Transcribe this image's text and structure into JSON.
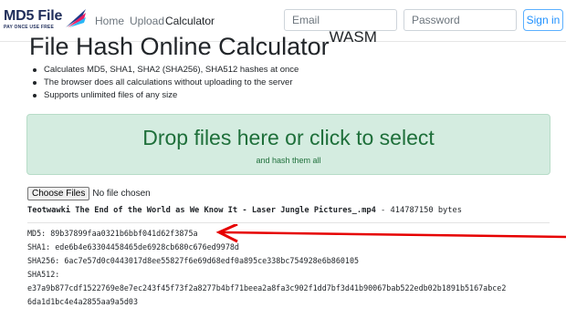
{
  "nav": {
    "logo_title": "MD5 File",
    "logo_tagline": "PAY ONCE USE FREE",
    "links": [
      {
        "label": "Home"
      },
      {
        "label": "Upload"
      },
      {
        "label": "Calculator"
      }
    ],
    "email_placeholder": "Email",
    "password_placeholder": "Password",
    "signin_label": "Sign in"
  },
  "page": {
    "title": "File Hash Online Calculator",
    "title_sup": "WASM",
    "bullets": [
      "Calculates MD5, SHA1, SHA2 (SHA256), SHA512 hashes at once",
      "The browser does all calculations without uploading to the server",
      "Supports unlimited files of any size"
    ]
  },
  "dropzone": {
    "title": "Drop files here or click to select",
    "subtitle": "and hash them all"
  },
  "file_input": {
    "button_label": "Choose Files",
    "status": "No file chosen"
  },
  "file": {
    "name": "Teotwawki The End of the World as We Know It - Laser Jungle Pictures_.mp4",
    "size_text": " - 414787150 bytes"
  },
  "hashes": {
    "md5_line": "MD5: 89b37899faa0321b6bbf041d62f3875a",
    "sha1_line": "SHA1: ede6b4e63304458465de6928cb680c676ed9978d",
    "sha256_line": "SHA256: 6ac7e57d0c0443017d8ee55827f6e69d68edf0a895ce338bc754928e6b860105",
    "sha512_label": "SHA512:",
    "sha512_line1": "e37a9b877cdf1522769e8e7ec243f45f73f2a8277b4bf71beea2a8fa3c902f1dd7bf3d41b90067bab522edb02b1891b5167abce2",
    "sha512_line2": "6da1d1bc4e4a2855aa9a5d03"
  },
  "colors": {
    "accent": "#1e90ff",
    "dropzone_bg": "#d4ece0",
    "dropzone_text": "#1e6f3a",
    "arrow": "#e60000"
  }
}
